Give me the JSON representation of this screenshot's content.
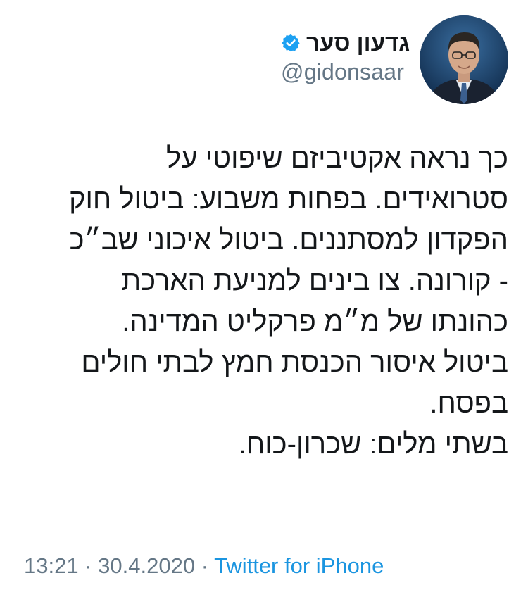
{
  "tweet": {
    "author": {
      "display_name": "גדעון סער",
      "handle": "@gidonsaar",
      "verified": true,
      "avatar_icon": "profile-photo"
    },
    "lines": [
      "כך נראה אקטיביזם שיפוטי על",
      "סטרואידים. בפחות משבוע: ביטול חוק",
      "הפקדון למסתננים. ביטול איכוני שב״כ",
      "- קורונה. צו בינים למניעת הארכת",
      "כהונתו של מ״מ פרקליט המדינה.",
      "ביטול איסור הכנסת חמץ לבתי חולים",
      "בפסח.",
      "בשתי מלים: שכרון-כוח."
    ],
    "time": "13:21",
    "separator": "·",
    "date": "30.4.2020",
    "source": "Twitter for iPhone"
  },
  "colors": {
    "text": "#14171a",
    "secondary": "#657786",
    "accent": "#1b95e0"
  },
  "icons": {
    "menu": "chevron-down-icon",
    "verified": "verified-badge-icon"
  }
}
